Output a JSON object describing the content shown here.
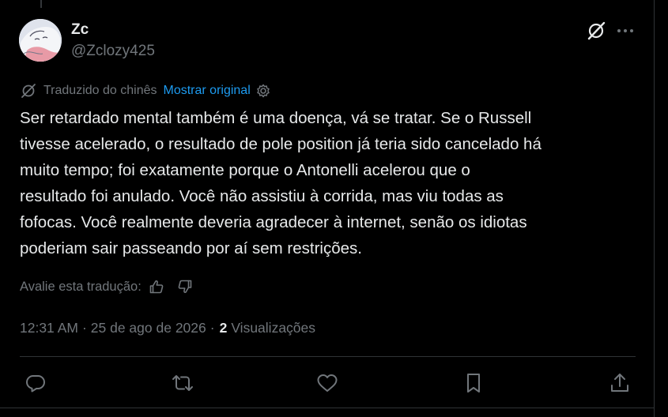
{
  "author": {
    "name": "Zc",
    "handle": "@Zclozy425"
  },
  "translation": {
    "note": "Traduzido do chinês",
    "show_original": "Mostrar original"
  },
  "tweet": {
    "text": "Ser retardado mental também é uma doença, vá se tratar. Se o Russell\ntivesse acelerado, o resultado de pole position já teria sido cancelado há\nmuito tempo; foi exatamente porque o Antonelli acelerou que o\nresultado foi anulado. Você não assistiu à corrida, mas viu todas as\nfofocas. Você realmente deveria agradecer à internet, senão os idiotas\npoderiam sair passeando por aí sem restrições."
  },
  "rating": {
    "label": "Avalie esta tradução:"
  },
  "meta": {
    "time": "12:31 AM",
    "separator": "·",
    "date": "25 de ago de 2026",
    "views_count": "2",
    "views_label": "Visualizações"
  },
  "icons": {
    "grok": "grok-icon",
    "more": "more-icon",
    "translate": "translate-icon",
    "settings": "gear-icon",
    "thumbs_up": "thumbs-up-icon",
    "thumbs_down": "thumbs-down-icon",
    "reply": "reply-icon",
    "repost": "repost-icon",
    "like": "heart-icon",
    "bookmark": "bookmark-icon",
    "share": "share-icon"
  },
  "colors": {
    "background": "#000000",
    "text": "#e7e9ea",
    "secondary": "#71767b",
    "link": "#1d9bf0",
    "border": "#2f3336"
  }
}
